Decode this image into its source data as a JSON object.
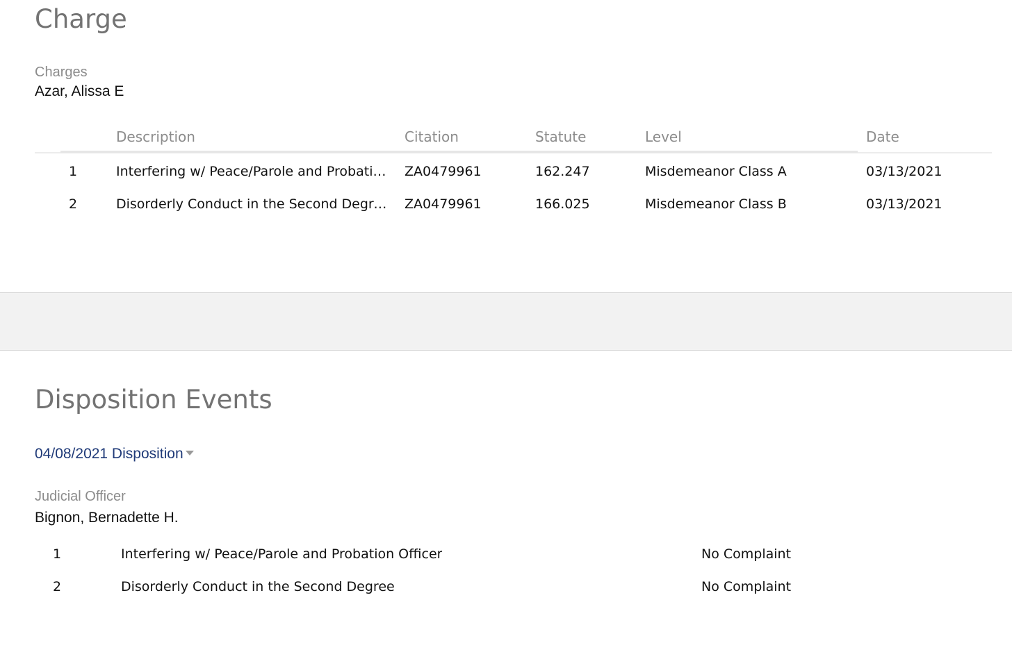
{
  "charge_section": {
    "title": "Charge",
    "charges_label": "Charges",
    "defendant": "Azar, Alissa E",
    "table": {
      "headers": [
        "Description",
        "Citation",
        "Statute",
        "Level",
        "Date"
      ],
      "rows": [
        {
          "number": "1",
          "description": "Interfering w/ Peace/Parole and Probation Officer",
          "citation": "ZA0479961",
          "statute": "162.247",
          "level": "Misdemeanor Class A",
          "date": "03/13/2021"
        },
        {
          "number": "2",
          "description": "Disorderly Conduct in the Second Degree",
          "citation": "ZA0479961",
          "statute": "166.025",
          "level": "Misdemeanor Class B",
          "date": "03/13/2021"
        }
      ]
    }
  },
  "disposition_section": {
    "title": "Disposition Events",
    "event_link": "04/08/2021 Disposition",
    "icons": {
      "event_toggle": "caret-down-icon"
    },
    "judicial_officer_label": "Judicial Officer",
    "judicial_officer": "Bignon, Bernadette H.",
    "rows": [
      {
        "number": "1",
        "charge": "Interfering w/ Peace/Parole and Probation Officer",
        "result": "No Complaint"
      },
      {
        "number": "2",
        "charge": "Disorderly Conduct in the Second Degree",
        "result": "No Complaint"
      }
    ]
  }
}
